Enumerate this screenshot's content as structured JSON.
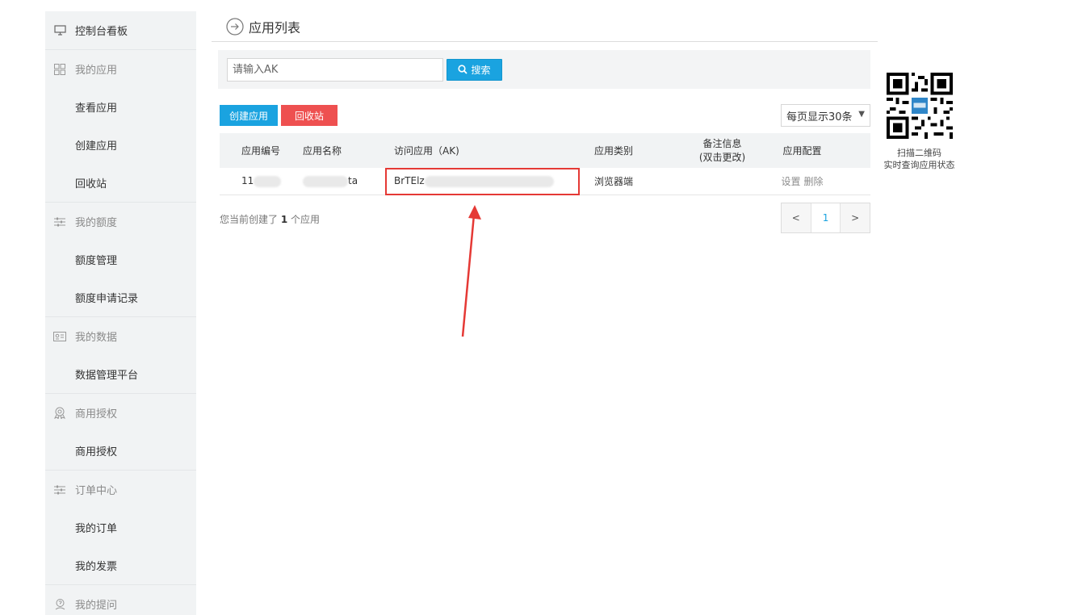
{
  "sidebar": {
    "dashboard": "控制台看板",
    "groups": [
      {
        "title": "我的应用",
        "icon": "grid-icon",
        "items": [
          "查看应用",
          "创建应用",
          "回收站"
        ]
      },
      {
        "title": "我的额度",
        "icon": "sliders-icon",
        "items": [
          "额度管理",
          "额度申请记录"
        ]
      },
      {
        "title": "我的数据",
        "icon": "id-card-icon",
        "items": [
          "数据管理平台"
        ]
      },
      {
        "title": "商用授权",
        "icon": "badge-icon",
        "items": [
          "商用授权"
        ]
      },
      {
        "title": "订单中心",
        "icon": "sliders-icon",
        "items": [
          "我的订单",
          "我的发票"
        ]
      },
      {
        "title": "我的提问",
        "icon": "question-user-icon",
        "items": []
      }
    ]
  },
  "header": {
    "title": "应用列表"
  },
  "search": {
    "placeholder": "请输入AK",
    "button": "搜索"
  },
  "actions": {
    "create": "创建应用",
    "recycle": "回收站",
    "page_size": "每页显示30条"
  },
  "table": {
    "columns": {
      "id": "应用编号",
      "name": "应用名称",
      "ak": "访问应用（AK)",
      "type": "应用类别",
      "note_line1": "备注信息",
      "note_line2": "(双击更改)",
      "config": "应用配置"
    },
    "rows": [
      {
        "id": "11",
        "name_suffix": "ta",
        "ak": "BrTElz",
        "type": "浏览器端",
        "setting": "设置",
        "delete": "删除"
      }
    ]
  },
  "footer": {
    "prefix": "您当前创建了",
    "count": "1",
    "suffix": "个应用"
  },
  "pager": {
    "prev": "<",
    "current": "1",
    "next": ">"
  },
  "qr": {
    "line1": "扫描二维码",
    "line2": "实时查询应用状态"
  },
  "colors": {
    "accent": "#1aa3e0",
    "danger": "#ee5050",
    "annotation": "#e53935"
  }
}
